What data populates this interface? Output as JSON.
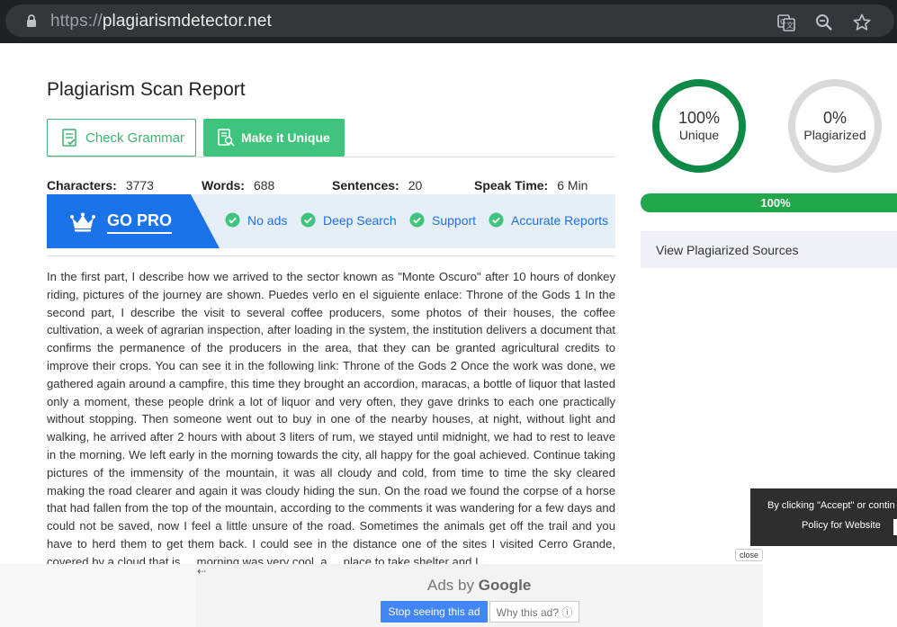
{
  "browser": {
    "url_scheme": "https://",
    "url_host": "plagiarismdetector.net"
  },
  "report": {
    "title": "Plagiarism Scan Report",
    "check_grammar_label": "Check Grammar",
    "make_unique_label": "Make it Unique",
    "stats": {
      "characters_label": "Characters:",
      "characters_value": "3773",
      "words_label": "Words:",
      "words_value": "688",
      "sentences_label": "Sentences:",
      "sentences_value": "20",
      "speak_label": "Speak Time:",
      "speak_value": "6 Min"
    },
    "pro": {
      "label": "GO PRO",
      "features": [
        "No ads",
        "Deep Search",
        "Support",
        "Accurate Reports"
      ]
    },
    "body_text": "In the first part, I describe how we arrived to the sector known as \"Monte Oscuro\" after 10 hours of donkey riding, pictures of the journey are shown. Puedes verlo en el siguiente enlace: Throne of the Gods 1 In the second part, I describe the visit to several coffee producers, some photos of their houses, the coffee cultivation, a week of agrarian inspection, after loading in the system, the institution delivers a document that confirms the permanence of the producers in the area, that they can be granted agricultural credits to improve their crops. You can see it in the following link: Throne of the Gods 2 Once the work was done, we gathered again around a campfire, this time they brought an accordion, maracas, a bottle of liquor that lasted only a moment, these people drink a lot of liquor and very often, they gave drinks to each one practically without stopping. Then someone went out to buy in one of the nearby houses, at night, without light and walking, he arrived after 2 hours with about 3 liters of rum, we stayed until midnight, we had to rest to leave in the morning. We left early in the morning towards the city, all happy for the goal achieved. Continue taking pictures of the immensity of the mountain, it was all cloudy and cold, from time to time the sky cleared making the road clearer and again it was cloudy hiding the sun. On the road we found the corpse of a horse that had fallen from the top of the mountain, according to the comments it was wandering for a few days and could not be saved, now I feel a little unsure of the road. Sometimes the animals get off the trail and you have to herd them to get them back. I could see in the distance one of the sites I visited Cerro Grande, covered by a cloud that is ... morning was very cool, a ... place to take shelter and I ..."
  },
  "results": {
    "unique_pct": "100%",
    "unique_label": "Unique",
    "plag_pct": "0%",
    "plag_label": "Plagiarized",
    "progress_label": "100%",
    "progress_value": 100,
    "sources_label": "View Plagiarized Sources"
  },
  "cookie": {
    "line1": "By clicking \"Accept\" or contin",
    "line2": "Policy for Website",
    "close_label": "close"
  },
  "ad": {
    "ads_by_label": "Ads by",
    "google_label": "Google",
    "stop_label": "Stop seeing this ad",
    "why_label": "Why this ad? ⓘ",
    "back_arrow": "⇠"
  },
  "colors": {
    "green": "#3ec47c",
    "dark_green": "#0f8a46",
    "blue": "#1a73e8",
    "progress": "#22a84a"
  }
}
